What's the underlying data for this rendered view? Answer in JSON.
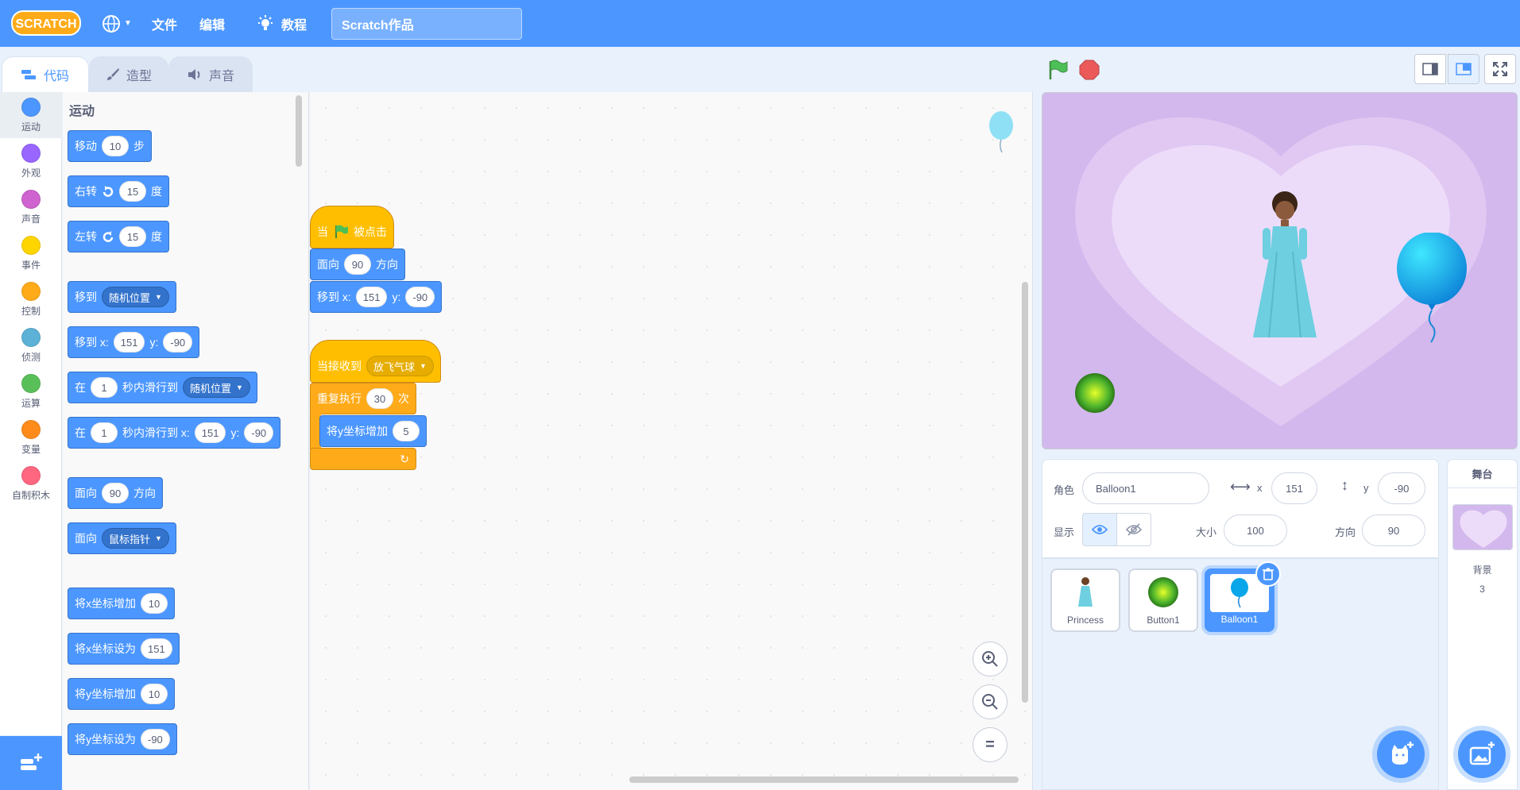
{
  "menubar": {
    "logo_text": "SCRATCH",
    "file_label": "文件",
    "edit_label": "编辑",
    "tutorials_label": "教程",
    "project_title": "Scratch作品"
  },
  "tabs": [
    {
      "label": "代码",
      "icon": "code-icon",
      "active": true
    },
    {
      "label": "造型",
      "icon": "brush-icon",
      "active": false
    },
    {
      "label": "声音",
      "icon": "speaker-icon",
      "active": false
    }
  ],
  "categories": [
    {
      "label": "运动",
      "color": "#4c97ff"
    },
    {
      "label": "外观",
      "color": "#9966ff"
    },
    {
      "label": "声音",
      "color": "#cf63cf"
    },
    {
      "label": "事件",
      "color": "#ffd500"
    },
    {
      "label": "控制",
      "color": "#ffab19"
    },
    {
      "label": "侦测",
      "color": "#5cb1d6"
    },
    {
      "label": "运算",
      "color": "#59c059"
    },
    {
      "label": "变量",
      "color": "#ff8c1a"
    },
    {
      "label": "自制积木",
      "color": "#ff6680"
    }
  ],
  "palette": {
    "title": "运动",
    "blocks": {
      "move": {
        "a": "移动",
        "v": "10",
        "b": "步"
      },
      "turn_right": {
        "a": "右转",
        "v": "15",
        "b": "度"
      },
      "turn_left": {
        "a": "左转",
        "v": "15",
        "b": "度"
      },
      "goto": {
        "a": "移到",
        "dd": "随机位置"
      },
      "goto_xy": {
        "a": "移到 x:",
        "x": "151",
        "ylabel": "y:",
        "y": "-90"
      },
      "glide": {
        "a": "在",
        "v": "1",
        "b": "秒内滑行到",
        "dd": "随机位置"
      },
      "glide_xy": {
        "a": "在",
        "v": "1",
        "b": "秒内滑行到 x:",
        "x": "151",
        "ylabel": "y:",
        "y": "-90"
      },
      "point": {
        "a": "面向",
        "v": "90",
        "b": "方向"
      },
      "point_towards": {
        "a": "面向",
        "dd": "鼠标指针"
      },
      "change_x": {
        "a": "将x坐标增加",
        "v": "10"
      },
      "set_x": {
        "a": "将x坐标设为",
        "v": "151"
      },
      "change_y": {
        "a": "将y坐标增加",
        "v": "10"
      },
      "set_y": {
        "a": "将y坐标设为",
        "v": "-90"
      }
    }
  },
  "script": {
    "flag_hat": {
      "a": "当",
      "b": "被点击"
    },
    "point": {
      "a": "面向",
      "v": "90",
      "b": "方向"
    },
    "goto_xy": {
      "a": "移到 x:",
      "x": "151",
      "ylabel": "y:",
      "y": "-90"
    },
    "receive_hat": {
      "a": "当接收到",
      "dd": "放飞气球"
    },
    "repeat": {
      "a": "重复执行",
      "v": "30",
      "b": "次"
    },
    "change_y": {
      "a": "将y坐标增加",
      "v": "5"
    }
  },
  "zoom": {
    "reset": "="
  },
  "sprite_info": {
    "sprite_label": "角色",
    "sprite_name": "Balloon1",
    "x_label": "x",
    "x": "151",
    "y_label": "y",
    "y": "-90",
    "show_label": "显示",
    "size_label": "大小",
    "size": "100",
    "direction_label": "方向",
    "direction": "90"
  },
  "sprites": [
    {
      "name": "Princess",
      "selected": false
    },
    {
      "name": "Button1",
      "selected": false
    },
    {
      "name": "Balloon1",
      "selected": true
    }
  ],
  "stage_pane": {
    "title": "舞台",
    "backdrop_label": "背景",
    "backdrop_count": "3"
  }
}
